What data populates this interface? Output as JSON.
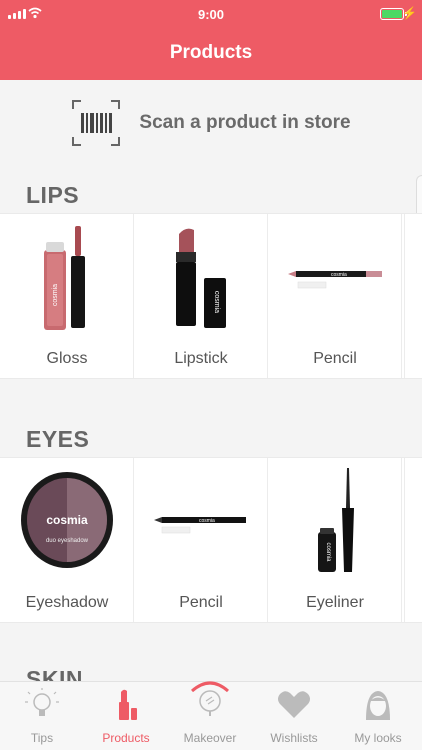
{
  "status_bar": {
    "time": "9:00",
    "battery_level": 1.0
  },
  "header": {
    "title": "Products"
  },
  "scan": {
    "label": "Scan a product in store",
    "icon": "barcode-scan-icon"
  },
  "sections": [
    {
      "title": "LIPS",
      "items": [
        {
          "label": "Gloss"
        },
        {
          "label": "Lipstick"
        },
        {
          "label": "Pencil"
        }
      ]
    },
    {
      "title": "EYES",
      "items": [
        {
          "label": "Eyeshadow"
        },
        {
          "label": "Pencil"
        },
        {
          "label": "Eyeliner"
        }
      ]
    },
    {
      "title": "SKIN"
    }
  ],
  "brand": "cosmia",
  "eyeshadow_sublabel": "duo eyeshadow",
  "tabs": [
    {
      "label": "Tips",
      "icon": "lightbulb-icon"
    },
    {
      "label": "Products",
      "icon": "lipstick-icon",
      "active": true
    },
    {
      "label": "Makeover",
      "icon": "mirror-icon"
    },
    {
      "label": "Wishlists",
      "icon": "heart-icon"
    },
    {
      "label": "My looks",
      "icon": "face-icon"
    }
  ],
  "colors": {
    "accent": "#ee5b65",
    "battery": "#4cd964"
  }
}
